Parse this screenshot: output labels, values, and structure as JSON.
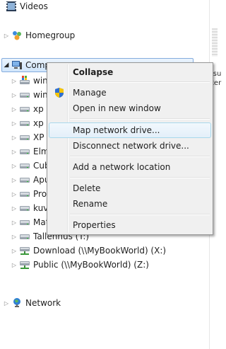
{
  "tree": {
    "videos": "Videos",
    "homegroup": "Homegroup",
    "computer": "Comp",
    "drives": [
      {
        "label": "win",
        "icon": "windows-drive-icon"
      },
      {
        "label": "win",
        "icon": "drive-icon"
      },
      {
        "label": "xp (",
        "icon": "drive-icon"
      },
      {
        "label": "xp p",
        "icon": "drive-icon"
      },
      {
        "label": "XP F",
        "icon": "drive-icon"
      },
      {
        "label": "Elm",
        "icon": "drive-icon"
      },
      {
        "label": "Cub",
        "icon": "drive-icon"
      },
      {
        "label": "Apu",
        "icon": "drive-icon"
      },
      {
        "label": "Proc",
        "icon": "drive-icon"
      },
      {
        "label": "kuv",
        "icon": "drive-icon"
      },
      {
        "label": "Mat",
        "icon": "drive-icon"
      },
      {
        "label": "Tallennus (T:)",
        "icon": "drive-icon"
      },
      {
        "label": "Download (\\\\MyBookWorld) (X:)",
        "icon": "network-drive-icon"
      },
      {
        "label": "Public (\\\\MyBookWorld) (Z:)",
        "icon": "network-drive-icon"
      }
    ],
    "network": "Network"
  },
  "right_pane": {
    "text": "isu\nter"
  },
  "context_menu": {
    "items": [
      {
        "label": "Collapse",
        "bold": true
      },
      {
        "label": "Manage",
        "icon": "uac-shield-icon"
      },
      {
        "label": "Open in new window"
      },
      {
        "label": "Map network drive...",
        "highlighted": true
      },
      {
        "label": "Disconnect network drive..."
      },
      {
        "label": "Add a network location"
      },
      {
        "label": "Delete"
      },
      {
        "label": "Rename"
      },
      {
        "label": "Properties"
      }
    ]
  }
}
